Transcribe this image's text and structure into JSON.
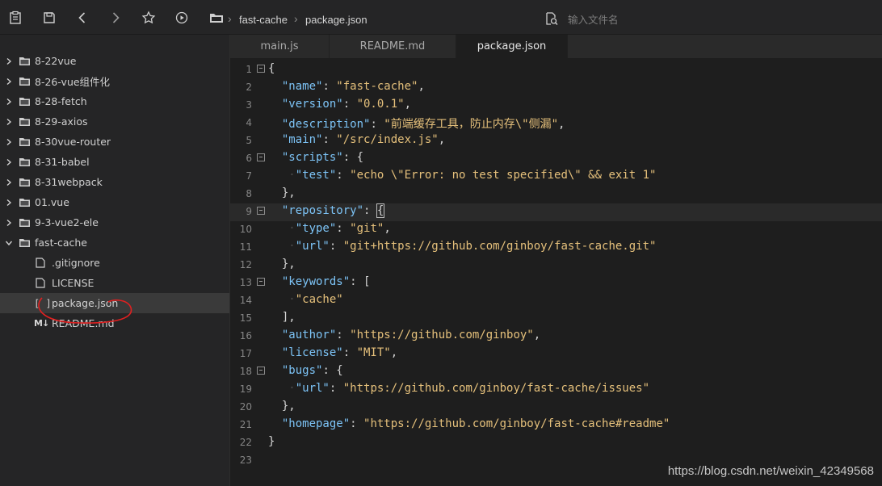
{
  "toolbar": {
    "icons": [
      "clipboard-icon",
      "save-icon",
      "chevron-left-icon",
      "chevron-right-icon",
      "star-icon",
      "play-circle-icon"
    ],
    "breadcrumb": [
      "fast-cache",
      "package.json"
    ],
    "search_placeholder": "输入文件名"
  },
  "sidebar": {
    "folders": [
      "8-22vue",
      "8-26-vue组件化",
      "8-28-fetch",
      "8-29-axios",
      "8-30vue-router",
      "8-31-babel",
      "8-31webpack",
      "01.vue",
      "9-3-vue2-ele"
    ],
    "open_folder": "fast-cache",
    "files": [
      ".gitignore",
      "LICENSE",
      "package.json",
      "README.md"
    ],
    "selected_file": "package.json"
  },
  "tabs": [
    "main.js",
    "README.md",
    "package.json"
  ],
  "active_tab": "package.json",
  "editor": {
    "current_line": 9,
    "fold_lines": [
      1,
      6,
      9,
      13,
      18
    ],
    "lines": [
      "{",
      "  \"name\": \"fast-cache\",",
      "  \"version\": \"0.0.1\",",
      "  \"description\": \"前端缓存工具，防止内存\\\"侧漏\",",
      "  \"main\": \"/src/index.js\",",
      "  \"scripts\": {",
      "    \"test\": \"echo \\\"Error: no test specified\\\" && exit 1\"",
      "  },",
      "  \"repository\": {",
      "    \"type\": \"git\",",
      "    \"url\": \"git+https://github.com/ginboy/fast-cache.git\"",
      "  },",
      "  \"keywords\": [",
      "    \"cache\"",
      "  ],",
      "  \"author\": \"https://github.com/ginboy\",",
      "  \"license\": \"MIT\",",
      "  \"bugs\": {",
      "    \"url\": \"https://github.com/ginboy/fast-cache/issues\"",
      "  },",
      "  \"homepage\": \"https://github.com/ginboy/fast-cache#readme\"",
      "}",
      ""
    ]
  },
  "watermark": "https://blog.csdn.net/weixin_42349568",
  "colors": {
    "background": "#1e1e1e",
    "sidebar": "#252526",
    "key": "#7dc4f7",
    "string": "#e5c07b",
    "annotation": "#e02020"
  }
}
